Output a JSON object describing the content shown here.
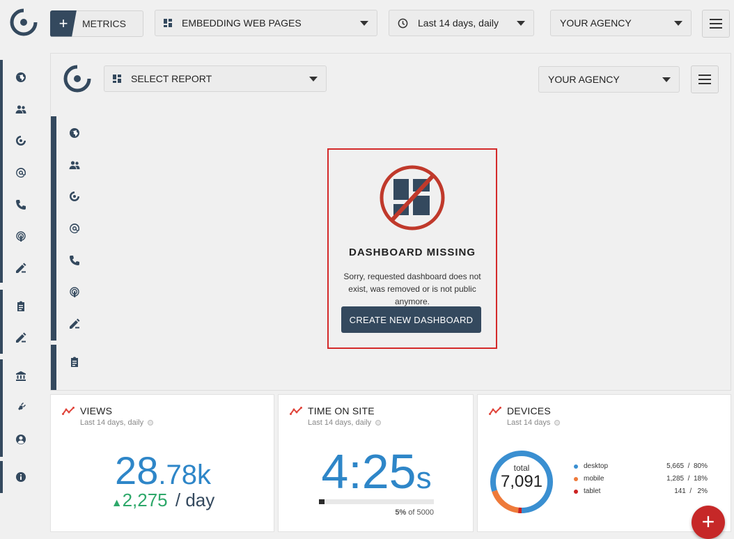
{
  "topbar": {
    "metrics_label": "METRICS",
    "dashboard_select": "EMBEDDING WEB PAGES",
    "date_select": "Last 14 days, daily",
    "agency_select": "YOUR AGENCY"
  },
  "embedded": {
    "report_select": "SELECT REPORT",
    "agency_select": "YOUR AGENCY",
    "missing_title": "DASHBOARD MISSING",
    "missing_text": "Sorry, requested dashboard does not exist, was removed or is not public anymore.",
    "create_button": "CREATE NEW DASHBOARD"
  },
  "widgets": {
    "views": {
      "title": "VIEWS",
      "subtitle": "Last 14 days, daily",
      "value_main": "28",
      "value_frac": ".78k",
      "delta": "2,275",
      "delta_suffix": "/ day"
    },
    "time_on_site": {
      "title": "TIME ON SITE",
      "subtitle": "Last 14 days, daily",
      "value": "4:25",
      "unit": "s",
      "progress_percent": 5,
      "progress_label": "5%",
      "progress_of": "of 5000"
    },
    "devices": {
      "title": "DEVICES",
      "subtitle": "Last 14 days",
      "total_label": "total",
      "total": "7,091",
      "items": [
        {
          "name": "desktop",
          "value": "5,665",
          "pct": "80%",
          "share": 80,
          "color": "#3a8fd1"
        },
        {
          "name": "mobile",
          "value": "1,285",
          "pct": "18%",
          "share": 18,
          "color": "#ee7a3a"
        },
        {
          "name": "tablet",
          "value": "141",
          "pct": "2%",
          "share": 2,
          "color": "#cc2222"
        }
      ]
    }
  },
  "colors": {
    "navy": "#34495e",
    "blue": "#2e86c8",
    "green": "#2ea86a",
    "red": "#c62828"
  }
}
